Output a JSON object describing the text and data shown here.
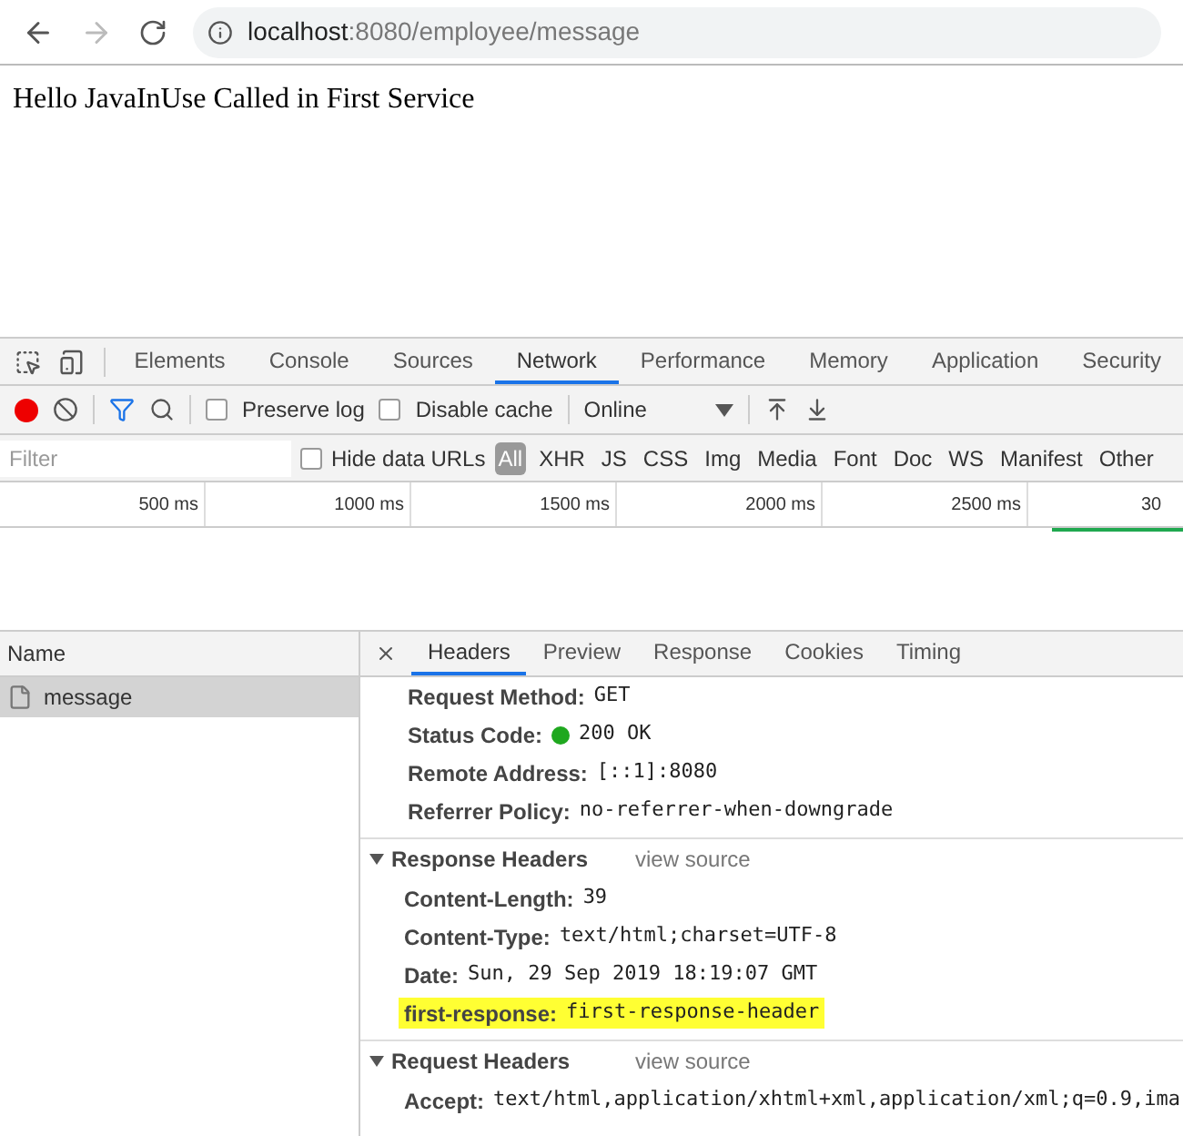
{
  "browser": {
    "url_host": "localhost",
    "url_path": ":8080/employee/message"
  },
  "page_text": "Hello JavaInUse Called in First Service",
  "devtools": {
    "tabs": [
      {
        "label": "Elements",
        "selected": false
      },
      {
        "label": "Console",
        "selected": false
      },
      {
        "label": "Sources",
        "selected": false
      },
      {
        "label": "Network",
        "selected": true
      },
      {
        "label": "Performance",
        "selected": false
      },
      {
        "label": "Memory",
        "selected": false
      },
      {
        "label": "Application",
        "selected": false
      },
      {
        "label": "Security",
        "selected": false
      }
    ],
    "toolbar": {
      "recording": true,
      "preserve_log": {
        "label": "Preserve log",
        "checked": false
      },
      "disable_cache": {
        "label": "Disable cache",
        "checked": false
      },
      "throttling": "Online"
    },
    "filter": {
      "placeholder": "Filter",
      "hide_data_urls": {
        "label": "Hide data URLs",
        "checked": false
      },
      "types": [
        {
          "label": "All",
          "selected": true
        },
        {
          "label": "XHR",
          "selected": false
        },
        {
          "label": "JS",
          "selected": false
        },
        {
          "label": "CSS",
          "selected": false
        },
        {
          "label": "Img",
          "selected": false
        },
        {
          "label": "Media",
          "selected": false
        },
        {
          "label": "Font",
          "selected": false
        },
        {
          "label": "Doc",
          "selected": false
        },
        {
          "label": "WS",
          "selected": false
        },
        {
          "label": "Manifest",
          "selected": false
        },
        {
          "label": "Other",
          "selected": false
        }
      ]
    },
    "timeline": {
      "ticks": [
        "500 ms",
        "1000 ms",
        "1500 ms",
        "2000 ms",
        "2500 ms",
        "30"
      ]
    },
    "requests": {
      "column": "Name",
      "rows": [
        {
          "name": "message",
          "selected": true
        }
      ]
    },
    "detail": {
      "tabs": [
        {
          "label": "Headers",
          "selected": true
        },
        {
          "label": "Preview",
          "selected": false
        },
        {
          "label": "Response",
          "selected": false
        },
        {
          "label": "Cookies",
          "selected": false
        },
        {
          "label": "Timing",
          "selected": false
        }
      ],
      "general": [
        {
          "name": "Request Method:",
          "value": "GET"
        },
        {
          "name": "Status Code:",
          "value": "200 OK",
          "color": "#1fa81f"
        },
        {
          "name": "Remote Address:",
          "value": "[::1]:8080"
        },
        {
          "name": "Referrer Policy:",
          "value": "no-referrer-when-downgrade"
        }
      ],
      "sections": [
        {
          "title": "Response Headers",
          "expanded": true,
          "view_source": "view source",
          "headers": [
            {
              "name": "Content-Length:",
              "value": "39",
              "highlighted": false
            },
            {
              "name": "Content-Type:",
              "value": "text/html;charset=UTF-8",
              "highlighted": false
            },
            {
              "name": "Date:",
              "value": "Sun, 29 Sep 2019 18:19:07 GMT",
              "highlighted": false
            },
            {
              "name": "first-response:",
              "value": "first-response-header",
              "highlighted": true
            }
          ]
        },
        {
          "title": "Request Headers",
          "expanded": true,
          "view_source": "view source",
          "headers": [
            {
              "name": "Accept:",
              "value": "text/html,application/xhtml+xml,application/xml;q=0.9,ima",
              "highlighted": false
            }
          ]
        }
      ]
    }
  }
}
